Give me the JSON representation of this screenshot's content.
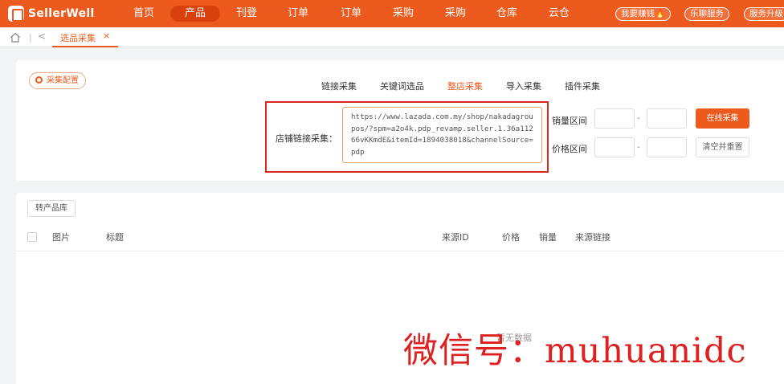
{
  "app": {
    "brand": "SellerWell"
  },
  "nav": {
    "items": [
      {
        "label": "首页",
        "active": false
      },
      {
        "label": "产品",
        "active": true
      },
      {
        "label": "刊登",
        "active": false
      },
      {
        "label": "订单",
        "active": false
      },
      {
        "label": "订单",
        "active": false
      },
      {
        "label": "采购",
        "active": false
      },
      {
        "label": "采购",
        "active": false
      },
      {
        "label": "仓库",
        "active": false
      },
      {
        "label": "云仓",
        "active": false
      }
    ],
    "pills": [
      {
        "label": "我要赚钱🔥"
      },
      {
        "label": "乐聊服务"
      },
      {
        "label": "服务升级"
      }
    ]
  },
  "tabs": {
    "active_label": "选品采集",
    "close_glyph": "×",
    "back_glyph": "<",
    "separator": "|"
  },
  "collect": {
    "config_button": "采集配置",
    "modes": [
      {
        "label": "链接采集",
        "active": false
      },
      {
        "label": "关键词选品",
        "active": false
      },
      {
        "label": "整店采集",
        "active": true
      },
      {
        "label": "导入采集",
        "active": false
      },
      {
        "label": "插件采集",
        "active": false
      }
    ],
    "store_link_label": "店铺链接采集：",
    "store_link_value": "https://www.lazada.com.my/shop/nakadagroupos/?spm=a2o4k.pdp_revamp.seller.1.36a11266vKKmdE&itemId=1894038018&channelSource=pdp",
    "sales_range_label": "销量区间",
    "price_range_label": "价格区间",
    "range_separator": "-",
    "online_collect_button": "在线采集",
    "clear_reset_button": "清空并重置"
  },
  "table": {
    "convert_button": "转产品库",
    "columns": [
      "图片",
      "标题",
      "来源ID",
      "价格",
      "销量",
      "来源链接"
    ],
    "empty_text": "暂无数据"
  },
  "watermark": {
    "text": "微信号：muhuanidc"
  },
  "colors": {
    "brand": "#ed5a1e",
    "highlight": "#d9281d"
  }
}
